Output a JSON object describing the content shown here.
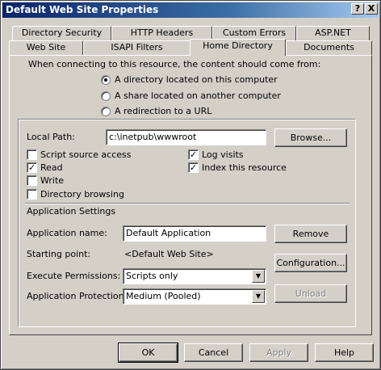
{
  "window": {
    "title": "Default Web Site Properties",
    "help_glyph": "?",
    "close_glyph": "X"
  },
  "tabs": {
    "row1": [
      "Directory Security",
      "HTTP Headers",
      "Custom Errors",
      "ASP.NET"
    ],
    "row2": [
      "Web Site",
      "ISAPI Filters",
      "Home Directory",
      "Documents"
    ],
    "active": "Home Directory"
  },
  "content_source": {
    "prompt": "When connecting to this resource, the content should come from:",
    "options": [
      {
        "label": "A directory located on this computer",
        "selected": true
      },
      {
        "label": "A share located on another computer",
        "selected": false
      },
      {
        "label": "A redirection to a URL",
        "selected": false
      }
    ]
  },
  "local_path": {
    "label": "Local Path:",
    "value": "c:\\inetpub\\wwwroot",
    "browse_label": "Browse..."
  },
  "permissions": {
    "left": [
      {
        "label": "Script source access",
        "checked": false
      },
      {
        "label": "Read",
        "checked": true
      },
      {
        "label": "Write",
        "checked": false
      },
      {
        "label": "Directory browsing",
        "checked": false
      }
    ],
    "right": [
      {
        "label": "Log visits",
        "checked": true
      },
      {
        "label": "Index this resource",
        "checked": true
      }
    ]
  },
  "app_settings": {
    "heading": "Application Settings",
    "name_label": "Application name:",
    "name_value": "Default Application",
    "remove_label": "Remove",
    "starting_point_label": "Starting point:",
    "starting_point_value": "<Default Web Site>",
    "configuration_label": "Configuration...",
    "execute_label": "Execute Permissions:",
    "execute_value": "Scripts only",
    "protection_label": "Application Protection:",
    "protection_value": "Medium (Pooled)",
    "unload_label": "Unload"
  },
  "footer": {
    "ok": "OK",
    "cancel": "Cancel",
    "apply": "Apply",
    "help": "Help"
  },
  "colors": {
    "face": "#d4d0c8",
    "title_start": "#0a246a",
    "title_end": "#a6caf0",
    "disabled_text": "#808080"
  }
}
